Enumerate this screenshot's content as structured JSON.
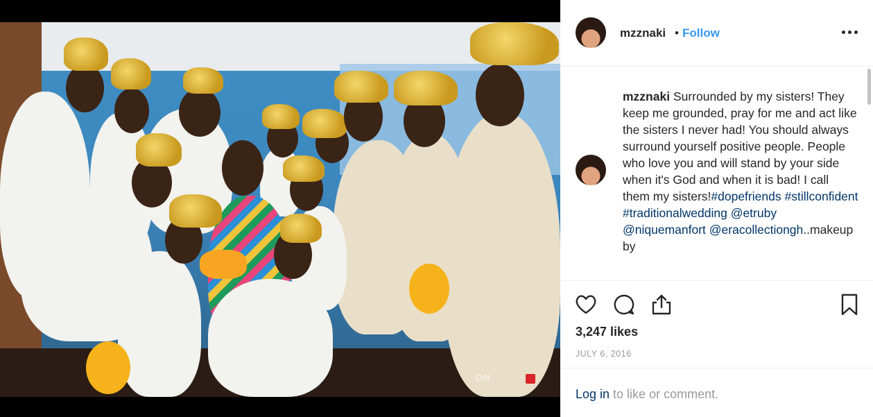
{
  "post": {
    "username": "mzznaki",
    "dot": "•",
    "follow_label": "Follow",
    "caption": {
      "username": "mzznaki",
      "text_parts": [
        {
          "type": "text",
          "value": " Surrounded by my sisters! They keep me grounded, pray for me and act like the sisters I never had! You should always surround yourself positive people. People who love you and will stand by your side when it's God and when it is bad! I call them my sisters!"
        },
        {
          "type": "link",
          "value": "#dopefriends"
        },
        {
          "type": "text",
          "value": " "
        },
        {
          "type": "link",
          "value": "#stillconfident"
        },
        {
          "type": "text",
          "value": " "
        },
        {
          "type": "link",
          "value": "#traditionalwedding"
        },
        {
          "type": "text",
          "value": " "
        },
        {
          "type": "link",
          "value": "@etruby"
        },
        {
          "type": "text",
          "value": " "
        },
        {
          "type": "link",
          "value": "@niquemanfort"
        },
        {
          "type": "text",
          "value": " "
        },
        {
          "type": "link",
          "value": "@eracollectiongh"
        },
        {
          "type": "text",
          "value": "..makeup by"
        }
      ]
    },
    "likes": "3,247 likes",
    "date": "JULY 6, 2016",
    "login_link": "Log in",
    "login_rest": " to like or comment."
  },
  "icons": {
    "more": "more-options-icon",
    "like": "heart-icon",
    "comment": "comment-icon",
    "share": "share-icon",
    "save": "bookmark-icon"
  },
  "colors": {
    "link": "#003569",
    "follow": "#3897f0",
    "text": "#262626",
    "muted": "#999999"
  }
}
